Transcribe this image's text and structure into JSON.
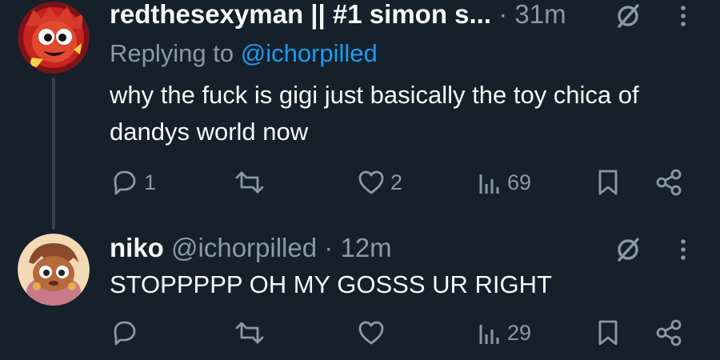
{
  "tweets": [
    {
      "display_name": "redthesexyman || #1 simon s...",
      "dot": "·",
      "time": "31m",
      "replying_prefix": "Replying to ",
      "replying_to": "@ichorpilled",
      "text": "why the fuck is gigi just basically the toy chica of dandys world now",
      "actions": {
        "reply_count": "1",
        "repost_count": "",
        "like_count": "2",
        "views_count": "69"
      }
    },
    {
      "display_name": "niko",
      "handle": "@ichorpilled",
      "dot": "·",
      "time": "12m",
      "text": "STOPPPPP OH MY GOSSS UR RIGHT",
      "actions": {
        "reply_count": "",
        "repost_count": "",
        "like_count": "",
        "views_count": "29"
      }
    }
  ],
  "colors": {
    "background": "#15202b",
    "text": "#f7f9f9",
    "secondary": "#8b98a5",
    "link": "#1d9bf0",
    "thread_line": "#38444d"
  },
  "icons": [
    "reply-icon",
    "repost-icon",
    "like-icon",
    "views-icon",
    "bookmark-icon",
    "share-icon",
    "grok-icon",
    "more-icon"
  ]
}
